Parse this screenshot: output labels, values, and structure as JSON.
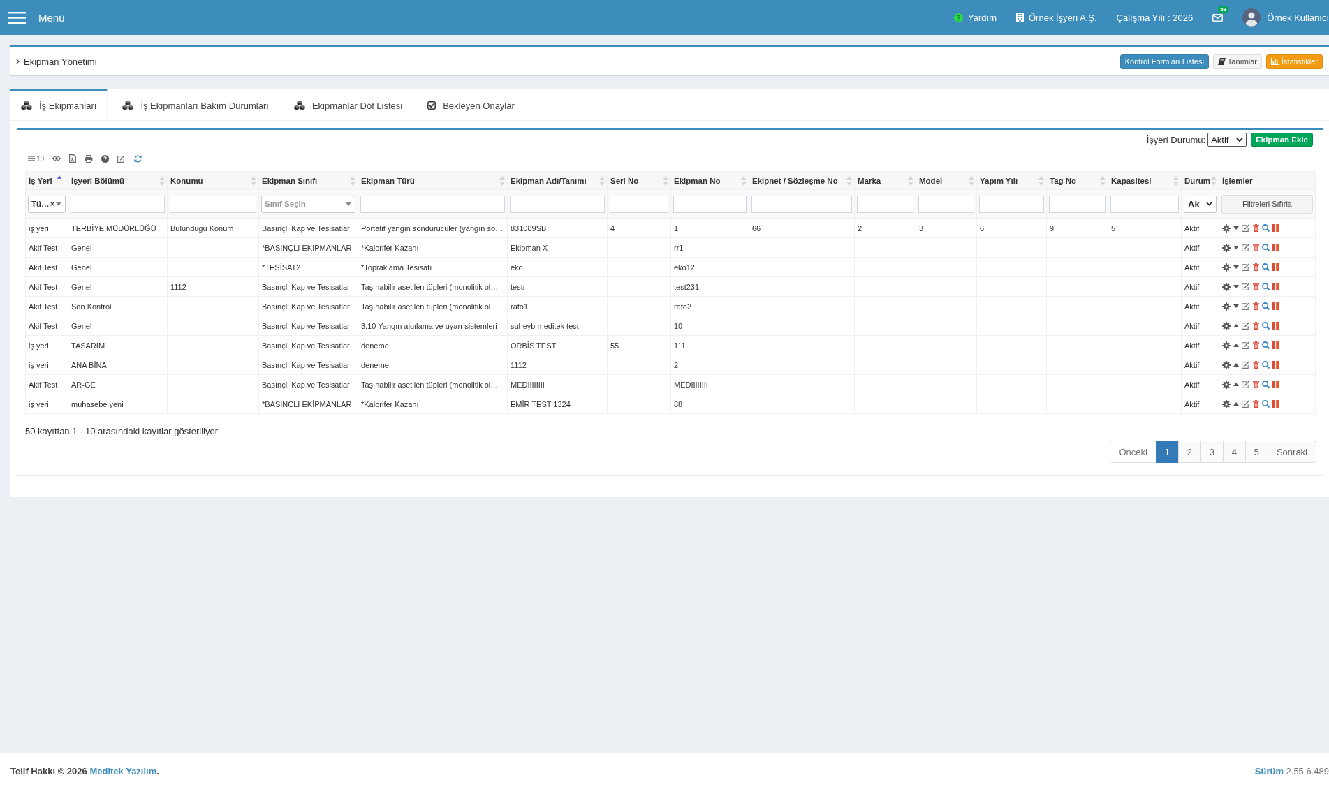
{
  "header": {
    "menu_label": "Menü",
    "help_label": "Yardım",
    "company": "Örnek İşyeri A.Ş.",
    "work_year": "Çalışma Yılı : 2026",
    "mail_count": "58",
    "user_name": "Örnek Kullanıcı"
  },
  "breadcrumb": {
    "title": "Ekipman Yönetimi",
    "buttons": [
      {
        "label": "Kontrol Formları Listesi",
        "kind": "primary"
      },
      {
        "label": "Tanımlar",
        "kind": "default"
      },
      {
        "label": "İstatistikler",
        "kind": "warning"
      }
    ]
  },
  "tabs": [
    {
      "label": "İş Ekipmanları",
      "kind": "equipment",
      "selected": true
    },
    {
      "label": "İş Ekipmanları Bakım Durumları",
      "kind": "equipment",
      "selected": false
    },
    {
      "label": "Ekipmanlar Döf Listesi",
      "kind": "equipment",
      "selected": false
    },
    {
      "label": "Bekleyen Onaylar",
      "kind": "approvals",
      "selected": false
    }
  ],
  "workplace_status": {
    "label": "İşyeri Durumu:",
    "value": "Aktif"
  },
  "add_button": "Ekipman Ekle",
  "toolbar": {
    "page_size": "10"
  },
  "table": {
    "columns": [
      {
        "label": "İş Yeri",
        "sortable": true,
        "sorted": true,
        "filter": {
          "kind": "select",
          "value": "Tü…",
          "clearable": true
        }
      },
      {
        "label": "İşyeri Bölümü",
        "sortable": true,
        "sorted": false,
        "filter": {
          "kind": "text"
        }
      },
      {
        "label": "Konumu",
        "sortable": true,
        "sorted": false,
        "filter": {
          "kind": "text"
        }
      },
      {
        "label": "Ekipman Sınıfı",
        "sortable": true,
        "sorted": false,
        "filter": {
          "kind": "select",
          "placeholder": "Sınıf Seçin",
          "clearable": false
        }
      },
      {
        "label": "Ekipman Türü",
        "sortable": true,
        "sorted": false,
        "filter": {
          "kind": "text"
        }
      },
      {
        "label": "Ekipman Adı/Tanımı",
        "sortable": true,
        "sorted": false,
        "filter": {
          "kind": "text"
        }
      },
      {
        "label": "Seri No",
        "sortable": true,
        "sorted": false,
        "filter": {
          "kind": "text"
        }
      },
      {
        "label": "Ekipman No",
        "sortable": true,
        "sorted": false,
        "filter": {
          "kind": "text"
        }
      },
      {
        "label": "Ekipnet / Sözleşme No",
        "sortable": true,
        "sorted": false,
        "filter": {
          "kind": "text"
        }
      },
      {
        "label": "Marka",
        "sortable": true,
        "sorted": false,
        "filter": {
          "kind": "text"
        }
      },
      {
        "label": "Model",
        "sortable": true,
        "sorted": false,
        "filter": {
          "kind": "text"
        }
      },
      {
        "label": "Yapım Yılı",
        "sortable": true,
        "sorted": false,
        "filter": {
          "kind": "text"
        }
      },
      {
        "label": "Tag No",
        "sortable": true,
        "sorted": false,
        "filter": {
          "kind": "text"
        }
      },
      {
        "label": "Kapasitesi",
        "sortable": true,
        "sorted": false,
        "filter": {
          "kind": "text"
        }
      },
      {
        "label": "Durum",
        "sortable": true,
        "sorted": false,
        "filter": {
          "kind": "dropdown",
          "value": "Ak"
        }
      },
      {
        "label": "İşlemler",
        "sortable": false,
        "sorted": false,
        "filter": {
          "kind": "button",
          "label": "Filtreleri Sıfırla"
        }
      }
    ],
    "rows": [
      {
        "workplace": "iş yeri",
        "department": "TERBİYE MÜDÜRLÜĞÜ",
        "location": "Bulunduğu Konum",
        "equipment_class": "Basınçlı Kap ve Tesisatlar",
        "equipment_type": "Portatif yangın söndürücüler (yangın sö…",
        "equipment_name": "831089SB",
        "serial_no": "4",
        "equipment_no": "1",
        "contract_no": "66",
        "brand": "2",
        "model": "3",
        "year": "6",
        "tag_no": "9",
        "capacity": "5",
        "status": "Aktif",
        "dropup": false
      },
      {
        "workplace": "Akif Test",
        "department": "Genel",
        "equipment_class": "*BASINÇLI EKİPMANLAR",
        "equipment_type": "*Kalorifer Kazanı",
        "equipment_name": "Ekipman X",
        "equipment_no": "rr1",
        "status": "Aktif",
        "dropup": false
      },
      {
        "workplace": "Akif Test",
        "department": "Genel",
        "equipment_class": "*TESİSAT2",
        "equipment_type": "*Topraklama Tesisatı",
        "equipment_name": "eko",
        "equipment_no": "eko12",
        "status": "Aktif",
        "dropup": false
      },
      {
        "workplace": "Akif Test",
        "department": "Genel",
        "location": "1112",
        "equipment_class": "Basınçlı Kap ve Tesisatlar",
        "equipment_type": "Taşınabilir asetilen tüpleri (monolitik ol…",
        "equipment_name": "testr",
        "equipment_no": "test231",
        "status": "Aktif",
        "dropup": false
      },
      {
        "workplace": "Akif Test",
        "department": "Son Kontrol",
        "equipment_class": "Basınçlı Kap ve Tesisatlar",
        "equipment_type": "Taşınabilir asetilen tüpleri (monolitik ol…",
        "equipment_name": "rafo1",
        "equipment_no": "rafo2",
        "status": "Aktif",
        "dropup": false
      },
      {
        "workplace": "Akif Test",
        "department": "Genel",
        "equipment_class": "Basınçlı Kap ve Tesisatlar",
        "equipment_type": "3.10 Yangın algılama ve uyarı sistemleri",
        "equipment_name": "suheyb meditek test",
        "equipment_no": "10",
        "status": "Aktif",
        "dropup": true
      },
      {
        "workplace": "iş yeri",
        "department": "TASARIM",
        "equipment_class": "Basınçlı Kap ve Tesisatlar",
        "equipment_type": "deneme",
        "equipment_name": "ORBİS TEST",
        "serial_no": "55",
        "equipment_no": "111",
        "status": "Aktif",
        "dropup": true
      },
      {
        "workplace": "iş yeri",
        "department": "ANA BİNA",
        "equipment_class": "Basınçlı Kap ve Tesisatlar",
        "equipment_type": "deneme",
        "equipment_name": "1112",
        "equipment_no": "2",
        "status": "Aktif",
        "dropup": true
      },
      {
        "workplace": "Akif Test",
        "department": "AR-GE",
        "equipment_class": "Basınçlı Kap ve Tesisatlar",
        "equipment_type": "Taşınabilir asetilen tüpleri (monolitik ol…",
        "equipment_name": "MEDİİİİİİİİ",
        "equipment_no": "MEDİİİİİİİİ",
        "status": "Aktif",
        "dropup": true
      },
      {
        "workplace": "iş yeri",
        "department": "muhasebe yeni",
        "equipment_class": "*BASINÇLI EKİPMANLAR",
        "equipment_type": "*Kalorifer Kazanı",
        "equipment_name": "EMİR TEST 1324",
        "equipment_no": "88",
        "status": "Aktif",
        "dropup": true
      }
    ]
  },
  "info": "50 kayıttan 1 - 10 arasındaki kayıtlar gösteriliyor",
  "pagination": {
    "previous": {
      "label": "Önceki",
      "disabled": true
    },
    "pages": [
      {
        "label": "1",
        "selected": true
      },
      {
        "label": "2",
        "selected": false
      },
      {
        "label": "3",
        "selected": false
      },
      {
        "label": "4",
        "selected": false
      },
      {
        "label": "5",
        "selected": false
      }
    ],
    "next": {
      "label": "Sonraki",
      "disabled": false
    }
  },
  "footer": {
    "copyright": "Telif Hakkı © 2026",
    "company_link": "Meditek Yazılım",
    "copyright_end": ".",
    "version": "**Sürüm** 2.55.6.489"
  }
}
